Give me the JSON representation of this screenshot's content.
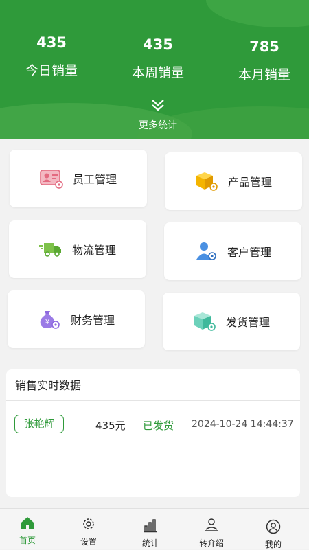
{
  "header": {
    "stats": [
      {
        "value": "435",
        "label": "今日销量"
      },
      {
        "value": "435",
        "label": "本周销量"
      },
      {
        "value": "785",
        "label": "本月销量"
      }
    ],
    "more_label": "更多统计",
    "more_icon": "double-chevron-down-icon"
  },
  "modules": [
    {
      "label": "员工管理",
      "icon": "employee-card-icon"
    },
    {
      "label": "产品管理",
      "icon": "product-box-icon"
    },
    {
      "label": "物流管理",
      "icon": "delivery-truck-icon"
    },
    {
      "label": "客户管理",
      "icon": "customer-user-icon"
    },
    {
      "label": "财务管理",
      "icon": "money-bag-icon"
    },
    {
      "label": "发货管理",
      "icon": "shipping-box-icon"
    }
  ],
  "sales": {
    "title": "销售实时数据",
    "rows": [
      {
        "name": "张艳辉",
        "amount": "435元",
        "status": "已发货",
        "time": "2024-10-24 14:44:37"
      }
    ]
  },
  "tabbar": [
    {
      "label": "首页",
      "icon": "home-icon",
      "active": true
    },
    {
      "label": "设置",
      "icon": "gear-icon",
      "active": false
    },
    {
      "label": "统计",
      "icon": "bar-chart-icon",
      "active": false
    },
    {
      "label": "转介绍",
      "icon": "referral-icon",
      "active": false
    },
    {
      "label": "我的",
      "icon": "profile-icon",
      "active": false
    }
  ],
  "colors": {
    "brand": "#2f9a3a",
    "background": "#f2f2f2"
  }
}
